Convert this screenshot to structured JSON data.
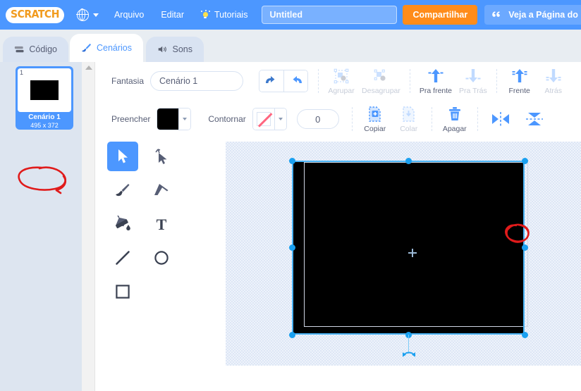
{
  "menubar": {
    "logo_text": "SCRATCH",
    "logo_icon": "scratch-logo",
    "globe_icon": "globe-icon",
    "lang_caret_icon": "chevron-down-icon",
    "items": [
      {
        "label": "Arquivo",
        "icon": ""
      },
      {
        "label": "Editar",
        "icon": ""
      },
      {
        "label": "Tutoriais",
        "icon": "lightbulb-icon"
      }
    ],
    "project_title": {
      "value": "Untitled",
      "placeholder": "Untitled"
    },
    "share_label": "Compartilhar",
    "page_label": "Veja a Página do",
    "page_icon": "folder-quote-icon",
    "accent_blue": "#4c97ff",
    "share_orange": "#ff8c1a"
  },
  "tabs": [
    {
      "label": "Código",
      "icon": "code-blocks-icon",
      "active": false
    },
    {
      "label": "Cenários",
      "icon": "paintbrush-icon",
      "active": true
    },
    {
      "label": "Sons",
      "icon": "speaker-icon",
      "active": false
    }
  ],
  "sidebar": {
    "scroll_up_icon": "scroll-up-arrow-icon",
    "costumes": [
      {
        "index": "1",
        "name": "Cenário 1",
        "size": "495 x 372",
        "selected": true
      }
    ]
  },
  "paint": {
    "row1": {
      "name_label": "Fantasia",
      "name_value": "Cenário 1",
      "undo_icon": "undo-arrow-icon",
      "redo_icon": "redo-arrow-icon",
      "buttons": [
        {
          "label": "Agrupar",
          "icon": "group-icon",
          "enabled": false
        },
        {
          "label": "Desagrupar",
          "icon": "ungroup-icon",
          "enabled": false
        },
        {
          "label": "Pra frente",
          "icon": "forward-one-icon",
          "enabled": true
        },
        {
          "label": "Pra Trás",
          "icon": "backward-one-icon",
          "enabled": false
        },
        {
          "label": "Frente",
          "icon": "front-icon",
          "enabled": true
        },
        {
          "label": "Atrás",
          "icon": "back-icon",
          "enabled": false
        }
      ]
    },
    "row2": {
      "fill_label": "Preencher",
      "fill_color": "#000000",
      "fill_caret_icon": "chevron-down-icon",
      "stroke_label": "Contornar",
      "stroke_color": "none",
      "stroke_caret_icon": "chevron-down-icon",
      "stroke_width": "0",
      "buttons": [
        {
          "label": "Copiar",
          "icon": "copy-icon",
          "enabled": true
        },
        {
          "label": "Colar",
          "icon": "paste-icon",
          "enabled": false
        },
        {
          "label": "Apagar",
          "icon": "trash-icon",
          "enabled": true
        }
      ],
      "flip_horizontal_icon": "flip-horizontal-icon",
      "flip_vertical_icon": "flip-vertical-icon"
    },
    "tools": [
      {
        "name": "select",
        "icon": "cursor-arrow-icon",
        "active": true
      },
      {
        "name": "reshape",
        "icon": "reshape-node-icon",
        "active": false
      },
      {
        "name": "brush",
        "icon": "paintbrush-icon",
        "active": false
      },
      {
        "name": "eraser",
        "icon": "eraser-icon",
        "active": false
      },
      {
        "name": "fill",
        "icon": "paint-bucket-icon",
        "active": false
      },
      {
        "name": "text",
        "icon": "text-t-icon",
        "active": false
      },
      {
        "name": "line",
        "icon": "line-icon",
        "active": false
      },
      {
        "name": "circle",
        "icon": "circle-icon",
        "active": false
      },
      {
        "name": "rectangle",
        "icon": "rectangle-icon",
        "active": false
      }
    ],
    "canvas": {
      "shape_color": "#000000",
      "selection_color": "#4ab3f4",
      "rotation_handle_icon": "rotate-handle-icon",
      "center_marker_icon": "crosshair-icon"
    },
    "annotations": [
      {
        "name": "thumbnail-size-circle",
        "color": "#e01b1b"
      },
      {
        "name": "corner-handle-circle",
        "color": "#e01b1b"
      }
    ]
  }
}
